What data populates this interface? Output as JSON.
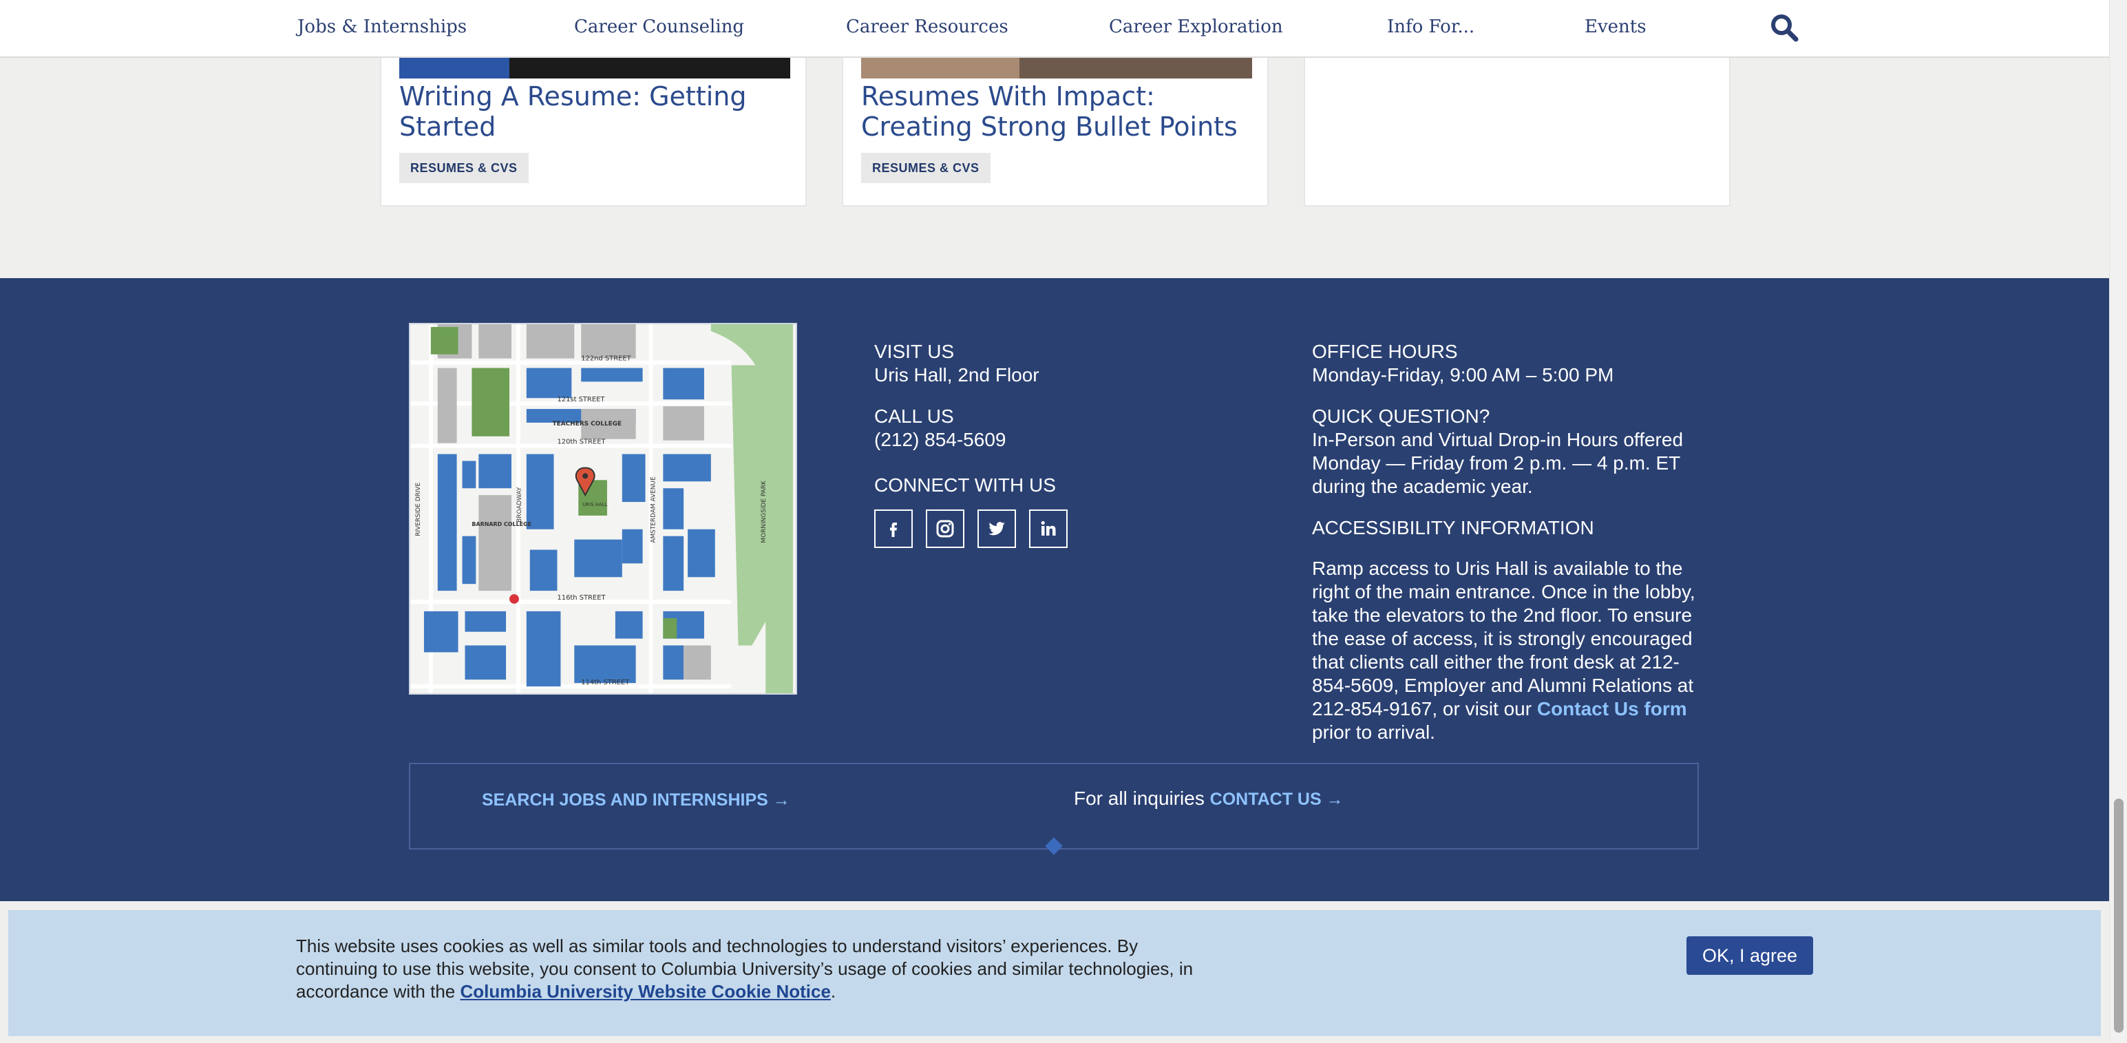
{
  "nav": {
    "items": [
      "Jobs & Internships",
      "Career Counseling",
      "Career Resources",
      "Career Exploration",
      "Info For...",
      "Events"
    ],
    "search_icon": "search-icon"
  },
  "cards": [
    {
      "title": "Writing A Resume: Getting Started",
      "tag": "RESUMES & CVS"
    },
    {
      "title": "Resumes With Impact: Creating Strong Bullet Points",
      "tag": "RESUMES & CVS"
    }
  ],
  "footer": {
    "visit_heading": "VISIT US",
    "visit_text": "Uris Hall, 2nd Floor",
    "call_heading": "CALL US",
    "call_text": "(212) 854-5609",
    "connect_heading": "CONNECT WITH US",
    "social": [
      "facebook-icon",
      "instagram-icon",
      "twitter-icon",
      "linkedin-icon"
    ],
    "office_heading": "OFFICE HOURS",
    "office_text": "Monday-Friday, 9:00 AM – 5:00 PM",
    "quick_heading": "QUICK QUESTION?",
    "quick_text": "In-Person and Virtual Drop-in Hours offered Monday — Friday from 2 p.m. — 4 p.m. ET during the academic year.",
    "access_heading": "ACCESSIBILITY INFORMATION",
    "access_text": "Ramp access to Uris Hall is available to the right of the main entrance. Once in the lobby, take the elevators to the 2nd floor. To ensure the ease of access, it is strongly encouraged that clients call either the front desk at 212-854-5609, Employer and Alumni Relations at 212-854-9167, or visit our",
    "access_link": "Contact Us form",
    "access_tail": "prior to arrival.",
    "cta_jobs": "SEARCH JOBS AND INTERNSHIPS →",
    "cta_inquiries_prefix": "For all inquiries",
    "cta_contact": "CONTACT US →",
    "map_labels": {
      "s122": "122nd STREET",
      "s121": "121st STREET",
      "s120": "120th STREET",
      "s116": "116th STREET",
      "s114": "114th STREET",
      "teachers": "TEACHERS COLLEGE",
      "barnard": "BARNARD COLLEGE",
      "broadway": "BROADWAY",
      "amsterdam": "AMSTERDAM AVENUE",
      "riverside": "RIVERSIDE DRIVE",
      "morningside": "MORNINGSIDE PARK",
      "uris": "URIS HALL"
    }
  },
  "cookie": {
    "text": "This website uses cookies as well as similar tools and technologies to understand visitors’ experiences. By continuing to use this website, you consent to Columbia University’s usage of cookies and similar technologies, in accordance with the",
    "link": "Columbia University Website Cookie Notice",
    "tail": ".",
    "button": "OK, I agree"
  },
  "colors": {
    "footer_bg": "#2a4071",
    "nav_text": "#2b3f71",
    "link": "#8ec3ff",
    "cookie_bg": "#c4d9ec",
    "button": "#2a4a94"
  }
}
